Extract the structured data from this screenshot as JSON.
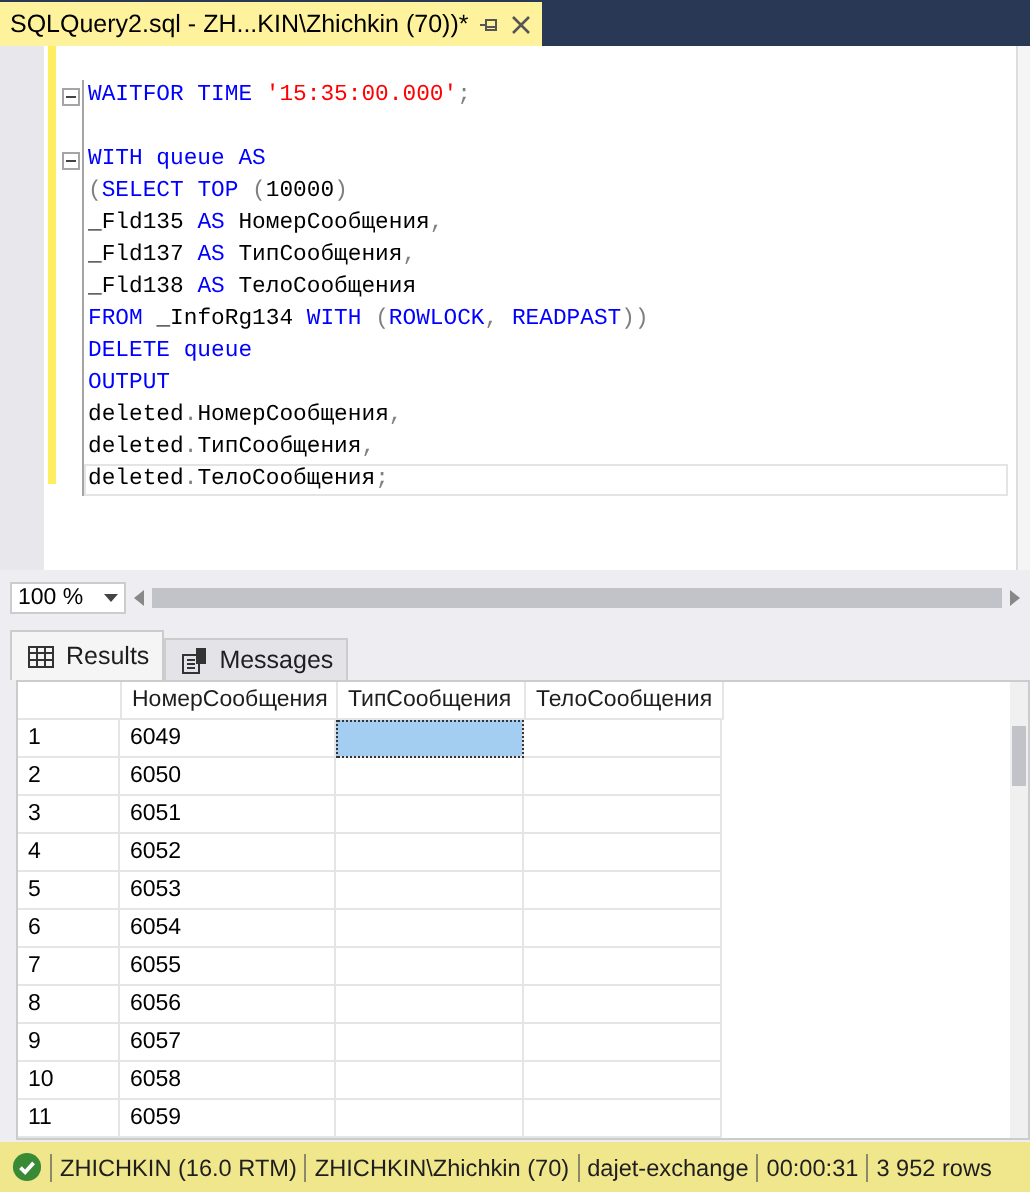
{
  "document_tab": {
    "title": "SQLQuery2.sql - ZH...KIN\\Zhichkin (70))*"
  },
  "editor": {
    "lines": [
      {
        "fold": true,
        "current": false,
        "tokens": [
          {
            "kind": "kw",
            "text": "WAITFOR TIME "
          },
          {
            "kind": "str",
            "text": "'15:35:00.000'"
          },
          {
            "kind": "op",
            "text": ";"
          }
        ]
      },
      {
        "fold": false,
        "current": false
      },
      {
        "fold": true,
        "current": false,
        "tokens": [
          {
            "kind": "kw",
            "text": "WITH queue AS"
          }
        ]
      },
      {
        "fold": false,
        "current": false,
        "tokens": [
          {
            "kind": "op",
            "text": "("
          },
          {
            "kind": "kw",
            "text": "SELECT TOP "
          },
          {
            "kind": "op",
            "text": "("
          },
          {
            "kind": "plain",
            "text": "10000"
          },
          {
            "kind": "op",
            "text": ")"
          }
        ]
      },
      {
        "fold": false,
        "current": false,
        "tokens": [
          {
            "kind": "plain",
            "text": "_Fld135 "
          },
          {
            "kind": "kw",
            "text": "AS"
          },
          {
            "kind": "plain",
            "text": " НомерСообщения"
          },
          {
            "kind": "op",
            "text": ","
          }
        ]
      },
      {
        "fold": false,
        "current": false,
        "tokens": [
          {
            "kind": "plain",
            "text": "_Fld137 "
          },
          {
            "kind": "kw",
            "text": "AS"
          },
          {
            "kind": "plain",
            "text": " ТипСообщения"
          },
          {
            "kind": "op",
            "text": ","
          }
        ]
      },
      {
        "fold": false,
        "current": false,
        "tokens": [
          {
            "kind": "plain",
            "text": "_Fld138 "
          },
          {
            "kind": "kw",
            "text": "AS"
          },
          {
            "kind": "plain",
            "text": " ТелоСообщения"
          }
        ]
      },
      {
        "fold": false,
        "current": false,
        "tokens": [
          {
            "kind": "kw",
            "text": "FROM "
          },
          {
            "kind": "plain",
            "text": "_InfoRg134 "
          },
          {
            "kind": "kw",
            "text": "WITH "
          },
          {
            "kind": "op",
            "text": "("
          },
          {
            "kind": "kw",
            "text": "ROWLOCK"
          },
          {
            "kind": "op",
            "text": ", "
          },
          {
            "kind": "kw",
            "text": "READPAST"
          },
          {
            "kind": "op",
            "text": "))"
          }
        ]
      },
      {
        "fold": false,
        "current": false,
        "tokens": [
          {
            "kind": "kw",
            "text": "DELETE queue"
          }
        ]
      },
      {
        "fold": false,
        "current": false,
        "tokens": [
          {
            "kind": "kw",
            "text": "OUTPUT"
          }
        ]
      },
      {
        "fold": false,
        "current": false,
        "tokens": [
          {
            "kind": "plain",
            "text": "deleted"
          },
          {
            "kind": "op",
            "text": "."
          },
          {
            "kind": "plain",
            "text": "НомерСообщения"
          },
          {
            "kind": "op",
            "text": ","
          }
        ]
      },
      {
        "fold": false,
        "current": false,
        "tokens": [
          {
            "kind": "plain",
            "text": "deleted"
          },
          {
            "kind": "op",
            "text": "."
          },
          {
            "kind": "plain",
            "text": "ТипСообщения"
          },
          {
            "kind": "op",
            "text": ","
          }
        ]
      },
      {
        "fold": false,
        "current": true,
        "tokens": [
          {
            "kind": "plain",
            "text": "deleted"
          },
          {
            "kind": "op",
            "text": "."
          },
          {
            "kind": "plain",
            "text": "ТелоСообщения"
          },
          {
            "kind": "op",
            "text": ";"
          }
        ]
      }
    ]
  },
  "zoom": {
    "value": "100 %"
  },
  "result_tabs": [
    {
      "label": "Results",
      "kind": "grid",
      "selected": true
    },
    {
      "label": "Messages",
      "kind": "messages",
      "selected": false
    }
  ],
  "grid": {
    "columns": [
      "НомерСообщения",
      "ТипСообщения",
      "ТелоСообщения"
    ],
    "rows": [
      {
        "number": "1",
        "cells": [
          {
            "text": "6049",
            "selected": false
          },
          {
            "selected": true
          },
          {
            "selected": false
          }
        ]
      },
      {
        "number": "2",
        "cells": [
          {
            "text": "6050",
            "selected": false
          },
          {
            "selected": false
          },
          {
            "selected": false
          }
        ]
      },
      {
        "number": "3",
        "cells": [
          {
            "text": "6051",
            "selected": false
          },
          {
            "selected": false
          },
          {
            "selected": false
          }
        ]
      },
      {
        "number": "4",
        "cells": [
          {
            "text": "6052",
            "selected": false
          },
          {
            "selected": false
          },
          {
            "selected": false
          }
        ]
      },
      {
        "number": "5",
        "cells": [
          {
            "text": "6053",
            "selected": false
          },
          {
            "selected": false
          },
          {
            "selected": false
          }
        ]
      },
      {
        "number": "6",
        "cells": [
          {
            "text": "6054",
            "selected": false
          },
          {
            "selected": false
          },
          {
            "selected": false
          }
        ]
      },
      {
        "number": "7",
        "cells": [
          {
            "text": "6055",
            "selected": false
          },
          {
            "selected": false
          },
          {
            "selected": false
          }
        ]
      },
      {
        "number": "8",
        "cells": [
          {
            "text": "6056",
            "selected": false
          },
          {
            "selected": false
          },
          {
            "selected": false
          }
        ]
      },
      {
        "number": "9",
        "cells": [
          {
            "text": "6057",
            "selected": false
          },
          {
            "selected": false
          },
          {
            "selected": false
          }
        ]
      },
      {
        "number": "10",
        "cells": [
          {
            "text": "6058",
            "selected": false
          },
          {
            "selected": false
          },
          {
            "selected": false
          }
        ]
      },
      {
        "number": "11",
        "cells": [
          {
            "text": "6059",
            "selected": false
          },
          {
            "selected": false
          },
          {
            "selected": false
          }
        ]
      }
    ]
  },
  "status_bar": {
    "indicator": {
      "kind": "success"
    },
    "items": [
      "ZHICHKIN (16.0 RTM)",
      "ZHICHKIN\\Zhichkin (70)",
      "dajet-exchange",
      "00:00:31",
      "3 952 rows"
    ]
  }
}
